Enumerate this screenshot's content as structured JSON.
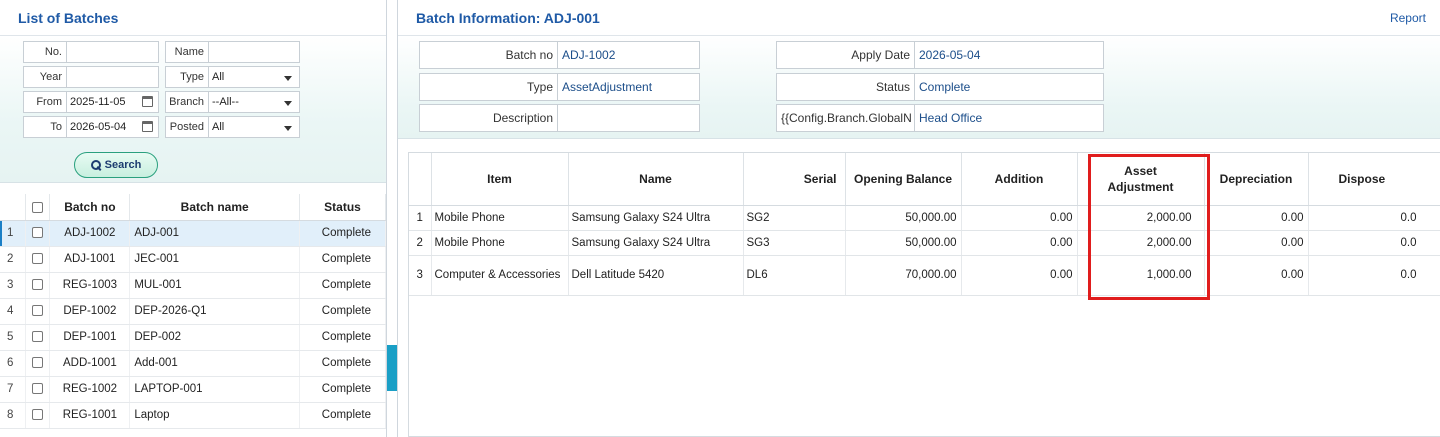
{
  "left": {
    "title": "List of Batches",
    "filters": {
      "no_label": "No.",
      "no_value": "",
      "name_label": "Name",
      "name_value": "",
      "year_label": "Year",
      "year_value": "",
      "type_label": "Type",
      "type_value": "All",
      "from_label": "From",
      "from_value": "2025-11-05",
      "branch_label": "Branch",
      "branch_value": "--All--",
      "to_label": "To",
      "to_value": "2026-05-04",
      "posted_label": "Posted",
      "posted_value": "All",
      "search_label": "Search"
    },
    "table": {
      "headers": {
        "batch_no": "Batch no",
        "batch_name": "Batch name",
        "status": "Status"
      },
      "rows": [
        {
          "n": "1",
          "no": "ADJ-1002",
          "name": "ADJ-001",
          "status": "Complete"
        },
        {
          "n": "2",
          "no": "ADJ-1001",
          "name": "JEC-001",
          "status": "Complete"
        },
        {
          "n": "3",
          "no": "REG-1003",
          "name": "MUL-001",
          "status": "Complete"
        },
        {
          "n": "4",
          "no": "DEP-1002",
          "name": "DEP-2026-Q1",
          "status": "Complete"
        },
        {
          "n": "5",
          "no": "DEP-1001",
          "name": "DEP-002",
          "status": "Complete"
        },
        {
          "n": "6",
          "no": "ADD-1001",
          "name": "Add-001",
          "status": "Complete"
        },
        {
          "n": "7",
          "no": "REG-1002",
          "name": "LAPTOP-001",
          "status": "Complete"
        },
        {
          "n": "8",
          "no": "REG-1001",
          "name": "Laptop",
          "status": "Complete"
        }
      ]
    }
  },
  "right": {
    "title": "Batch Information: ADJ-001",
    "report_label": "Report",
    "info": {
      "batch_no_label": "Batch no",
      "batch_no_value": "ADJ-1002",
      "type_label": "Type",
      "type_value": "AssetAdjustment",
      "description_label": "Description",
      "description_value": "",
      "apply_date_label": "Apply Date",
      "apply_date_value": "2026-05-04",
      "status_label": "Status",
      "status_value": "Complete",
      "branch_label": "{{Config.Branch.GlobalN",
      "branch_value": "Head Office"
    },
    "detail": {
      "headers": {
        "item": "Item",
        "name": "Name",
        "serial": "Serial",
        "opening": "Opening Balance",
        "addition": "Addition",
        "adjustment": "Asset Adjustment",
        "depreciation": "Depreciation",
        "dispose": "Dispose"
      },
      "rows": [
        {
          "n": "1",
          "item": "Mobile Phone",
          "name": "Samsung Galaxy S24 Ultra",
          "serial": "SG2",
          "opening": "50,000.00",
          "addition": "0.00",
          "adjustment": "2,000.00",
          "depreciation": "0.00",
          "dispose": "0.0"
        },
        {
          "n": "2",
          "item": "Mobile Phone",
          "name": "Samsung Galaxy S24 Ultra",
          "serial": "SG3",
          "opening": "50,000.00",
          "addition": "0.00",
          "adjustment": "2,000.00",
          "depreciation": "0.00",
          "dispose": "0.0"
        },
        {
          "n": "3",
          "item": "Computer & Accessories",
          "name": "Dell Latitude 5420",
          "serial": "DL6",
          "opening": "70,000.00",
          "addition": "0.00",
          "adjustment": "1,000.00",
          "depreciation": "0.00",
          "dispose": "0.0"
        }
      ]
    }
  }
}
